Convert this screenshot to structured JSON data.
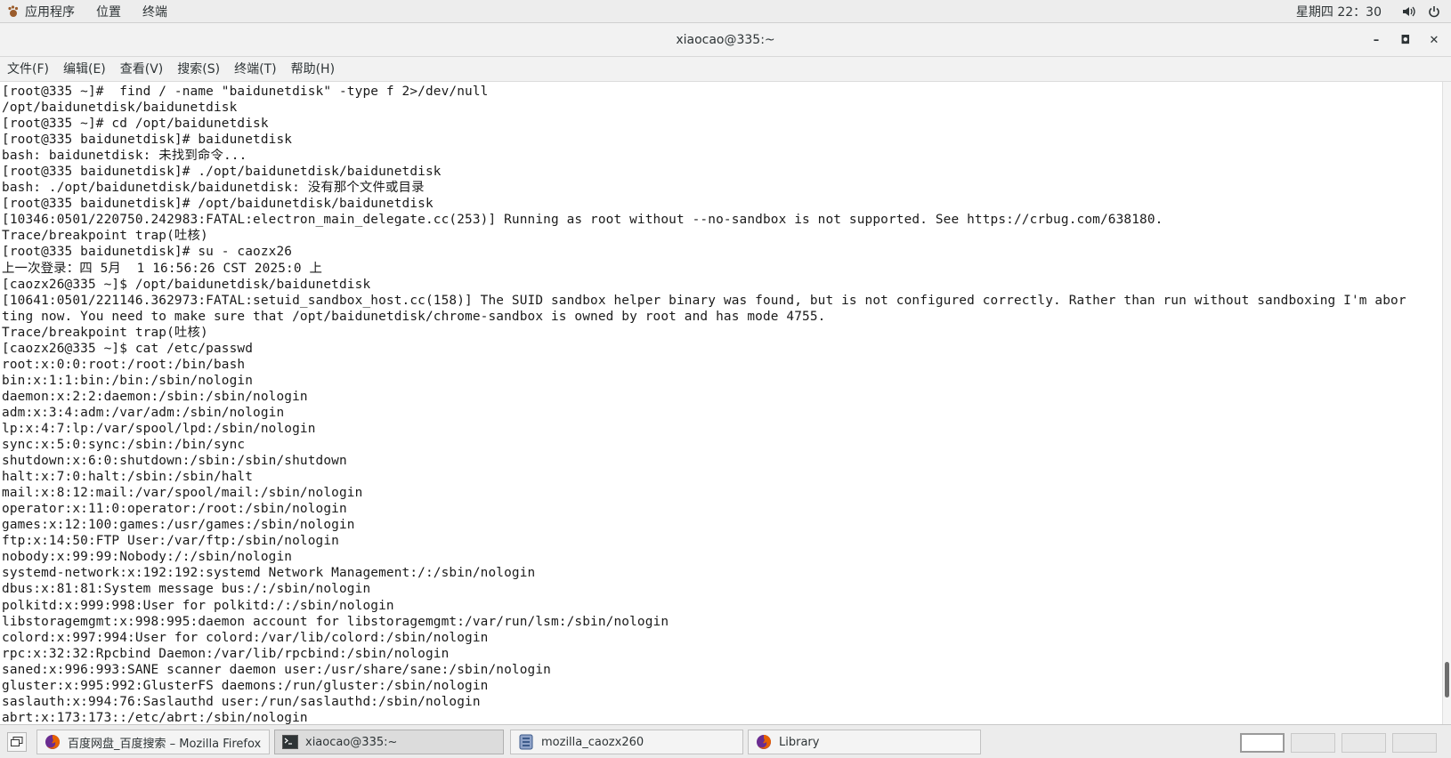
{
  "top_panel": {
    "applications": "应用程序",
    "places": "位置",
    "terminal": "终端",
    "clock": "星期四 22：30",
    "volume_icon": "speaker-icon",
    "power_icon": "power-icon"
  },
  "window": {
    "title": "xiaocao@335:~",
    "minimize_glyph": "–",
    "maximize_glyph": "◘",
    "close_glyph": "✕"
  },
  "menubar": {
    "items": [
      "文件(F)",
      "编辑(E)",
      "查看(V)",
      "搜索(S)",
      "终端(T)",
      "帮助(H)"
    ]
  },
  "terminal": {
    "lines": [
      "[root@335 ~]#  find / -name \"baidunetdisk\" -type f 2>/dev/null",
      "/opt/baidunetdisk/baidunetdisk",
      "[root@335 ~]# cd /opt/baidunetdisk",
      "[root@335 baidunetdisk]# baidunetdisk",
      "bash: baidunetdisk: 未找到命令...",
      "[root@335 baidunetdisk]# ./opt/baidunetdisk/baidunetdisk",
      "bash: ./opt/baidunetdisk/baidunetdisk: 没有那个文件或目录",
      "[root@335 baidunetdisk]# /opt/baidunetdisk/baidunetdisk",
      "[10346:0501/220750.242983:FATAL:electron_main_delegate.cc(253)] Running as root without --no-sandbox is not supported. See https://crbug.com/638180.",
      "Trace/breakpoint trap(吐核)",
      "[root@335 baidunetdisk]# su - caozx26",
      "上一次登录：四 5月  1 16:56:26 CST 2025:0 上",
      "[caozx26@335 ~]$ /opt/baidunetdisk/baidunetdisk",
      "[10641:0501/221146.362973:FATAL:setuid_sandbox_host.cc(158)] The SUID sandbox helper binary was found, but is not configured correctly. Rather than run without sandboxing I'm abor",
      "ting now. You need to make sure that /opt/baidunetdisk/chrome-sandbox is owned by root and has mode 4755.",
      "Trace/breakpoint trap(吐核)",
      "[caozx26@335 ~]$ cat /etc/passwd",
      "root:x:0:0:root:/root:/bin/bash",
      "bin:x:1:1:bin:/bin:/sbin/nologin",
      "daemon:x:2:2:daemon:/sbin:/sbin/nologin",
      "adm:x:3:4:adm:/var/adm:/sbin/nologin",
      "lp:x:4:7:lp:/var/spool/lpd:/sbin/nologin",
      "sync:x:5:0:sync:/sbin:/bin/sync",
      "shutdown:x:6:0:shutdown:/sbin:/sbin/shutdown",
      "halt:x:7:0:halt:/sbin:/sbin/halt",
      "mail:x:8:12:mail:/var/spool/mail:/sbin/nologin",
      "operator:x:11:0:operator:/root:/sbin/nologin",
      "games:x:12:100:games:/usr/games:/sbin/nologin",
      "ftp:x:14:50:FTP User:/var/ftp:/sbin/nologin",
      "nobody:x:99:99:Nobody:/:/sbin/nologin",
      "systemd-network:x:192:192:systemd Network Management:/:/sbin/nologin",
      "dbus:x:81:81:System message bus:/:/sbin/nologin",
      "polkitd:x:999:998:User for polkitd:/:/sbin/nologin",
      "libstoragemgmt:x:998:995:daemon account for libstoragemgmt:/var/run/lsm:/sbin/nologin",
      "colord:x:997:994:User for colord:/var/lib/colord:/sbin/nologin",
      "rpc:x:32:32:Rpcbind Daemon:/var/lib/rpcbind:/sbin/nologin",
      "saned:x:996:993:SANE scanner daemon user:/usr/share/sane:/sbin/nologin",
      "gluster:x:995:992:GlusterFS daemons:/run/gluster:/sbin/nologin",
      "saslauth:x:994:76:Saslauthd user:/run/saslauthd:/sbin/nologin",
      "abrt:x:173:173::/etc/abrt:/sbin/nologin"
    ]
  },
  "taskbar": {
    "tasks": [
      {
        "label": "百度网盘_百度搜索 – Mozilla Firefox",
        "icon": "firefox-icon"
      },
      {
        "label": "xiaocao@335:~",
        "icon": "terminal-icon"
      },
      {
        "label": "mozilla_caozx260",
        "icon": "archive-icon"
      },
      {
        "label": "Library",
        "icon": "firefox-icon"
      }
    ],
    "workspaces": 4,
    "active_workspace": 1
  },
  "colors": {
    "panel_bg": "#ededed",
    "terminal_bg": "#ffffff",
    "terminal_fg": "#1a1a1a",
    "firefox_orange": "#e66000",
    "firefox_purple": "#6a2c91"
  }
}
